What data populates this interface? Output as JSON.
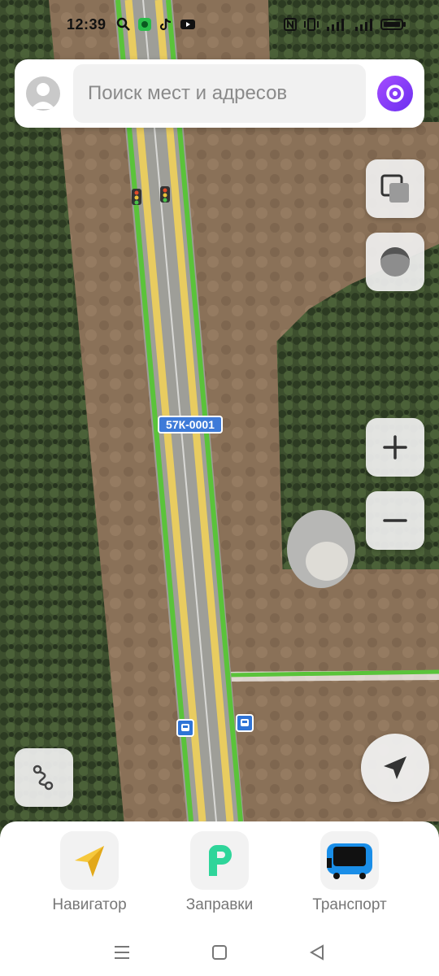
{
  "status_bar": {
    "time": "12:39",
    "left_icons": [
      "search-icon",
      "app-notification-icon",
      "tiktok-icon",
      "youtube-icon"
    ],
    "right_icons": [
      "nfc-icon",
      "vibrate-icon",
      "signal-icon",
      "signal-icon",
      "battery-icon"
    ]
  },
  "search": {
    "placeholder": "Поиск мест и адресов",
    "value": ""
  },
  "map": {
    "road_label": "57К-0001",
    "controls": [
      "layers-button",
      "map-mode-button",
      "zoom-in-button",
      "zoom-out-button",
      "route-button",
      "my-location-button"
    ]
  },
  "shortcuts": [
    {
      "label": "Навигатор",
      "icon": "navigator-arrow-icon"
    },
    {
      "label": "Заправки",
      "icon": "gas-station-p-icon"
    },
    {
      "label": "Транспорт",
      "icon": "bus-icon"
    }
  ],
  "colors": {
    "road_green": "#5ac33a",
    "road_yellow": "#f1d25a",
    "alice_purple": "#7b35f5",
    "road_sign_blue": "#3d7ad8"
  }
}
